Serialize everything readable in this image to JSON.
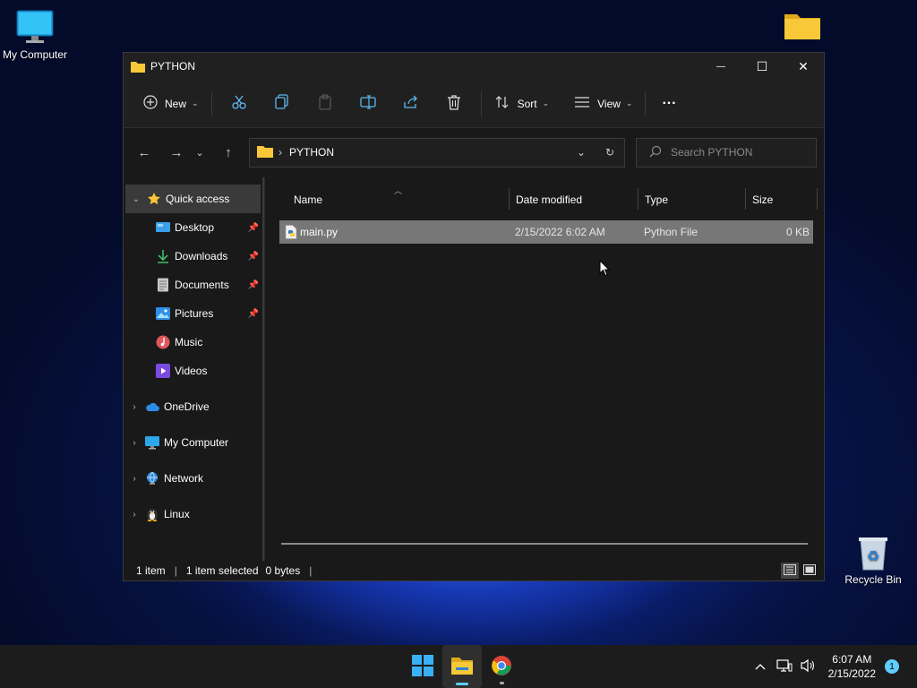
{
  "desktop": {
    "icons": [
      {
        "label": "My Computer"
      },
      {
        "label": ""
      },
      {
        "label": "Recycle Bin"
      }
    ]
  },
  "window": {
    "title": "PYTHON",
    "controls": {
      "minimize": "—",
      "maximize": "☐",
      "close": "✕"
    }
  },
  "toolbar": {
    "new_label": "New",
    "sort_label": "Sort",
    "view_label": "View",
    "more_label": "···"
  },
  "navigation": {
    "breadcrumb": "PYTHON",
    "search_placeholder": "Search PYTHON"
  },
  "sidebar": {
    "quick_access": "Quick access",
    "pinned": [
      {
        "label": "Desktop"
      },
      {
        "label": "Downloads"
      },
      {
        "label": "Documents"
      },
      {
        "label": "Pictures"
      }
    ],
    "unpinned": [
      {
        "label": "Music"
      },
      {
        "label": "Videos"
      }
    ],
    "roots": [
      {
        "label": "OneDrive"
      },
      {
        "label": "My Computer"
      },
      {
        "label": "Network"
      },
      {
        "label": "Linux"
      }
    ]
  },
  "columns": {
    "name": "Name",
    "date": "Date modified",
    "type": "Type",
    "size": "Size"
  },
  "files": [
    {
      "name": "main.py",
      "date": "2/15/2022 6:02 AM",
      "type": "Python File",
      "size": "0 KB"
    }
  ],
  "status": {
    "count": "1 item",
    "selected": "1 item selected",
    "bytes": "0 bytes"
  },
  "taskbar": {
    "time": "6:07 AM",
    "date": "2/15/2022",
    "notifications": "1"
  },
  "colors": {
    "accent": "#60cdff",
    "folder": "#f8c838",
    "selection": "#777777"
  }
}
